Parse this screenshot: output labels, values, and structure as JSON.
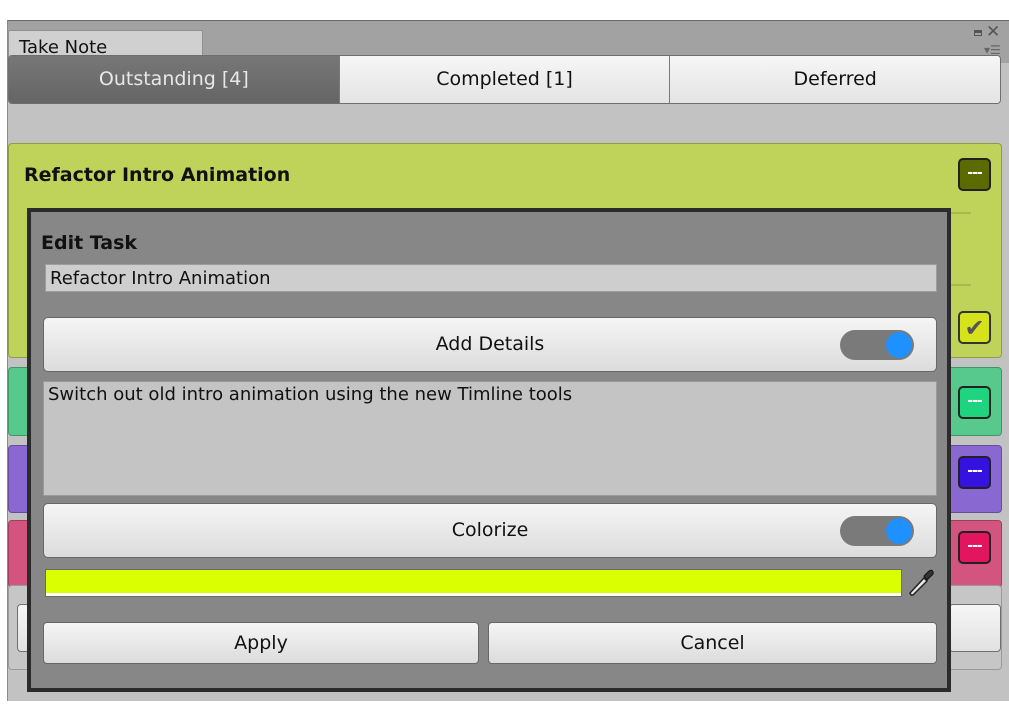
{
  "window": {
    "tab_title": "Take Note"
  },
  "tabs": [
    {
      "label": "Outstanding [4]",
      "active": true
    },
    {
      "label": "Completed [1]",
      "active": false
    },
    {
      "label": "Deferred",
      "active": false
    }
  ],
  "tasks": [
    {
      "title": "Refactor Intro Animation",
      "color": "#bfd35a",
      "button_color": "#5c6b00"
    },
    {
      "title": "",
      "color": "#57c98d",
      "button_color": "#1fd47e"
    },
    {
      "title": "",
      "color": "#8a68d2",
      "button_color": "#3612e0"
    },
    {
      "title": "",
      "color": "#d3557f",
      "button_color": "#e2155e"
    }
  ],
  "task_menu_glyph": "---",
  "check_glyph": "✔",
  "edit_dialog": {
    "title": "Edit Task",
    "name_value": "Refactor Intro Animation",
    "add_details_label": "Add Details",
    "add_details_on": true,
    "details_value": "Switch out old intro animation using the new Timline tools",
    "colorize_label": "Colorize",
    "colorize_on": true,
    "color": "#d9ff00",
    "apply_label": "Apply",
    "cancel_label": "Cancel"
  },
  "colors": {
    "toggle_knob": "#1e90ff",
    "active_tab": "#6e6e6e"
  }
}
